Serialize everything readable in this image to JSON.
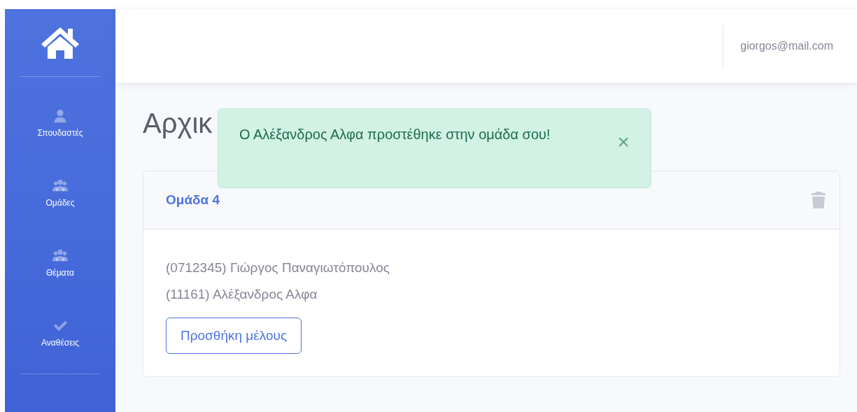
{
  "sidebar": {
    "items": [
      {
        "label": "Σπουδαστές"
      },
      {
        "label": "Ομάδες"
      },
      {
        "label": "Θέματα"
      },
      {
        "label": "Αναθέσεις"
      }
    ]
  },
  "topbar": {
    "user": "giorgos@mail.com"
  },
  "page_title": "Αρχικ",
  "toast": {
    "message": "Ο Αλέξανδρος Αλφα προστέθηκε στην ομάδα σου!",
    "close": "×"
  },
  "group_card": {
    "title": "Ομάδα 4",
    "members": [
      "(0712345) Γιώργος Παναγιωτόπουλος",
      "(11161) Αλέξανδρος Αλφα"
    ],
    "add_button": "Προσθήκη μέλους"
  }
}
